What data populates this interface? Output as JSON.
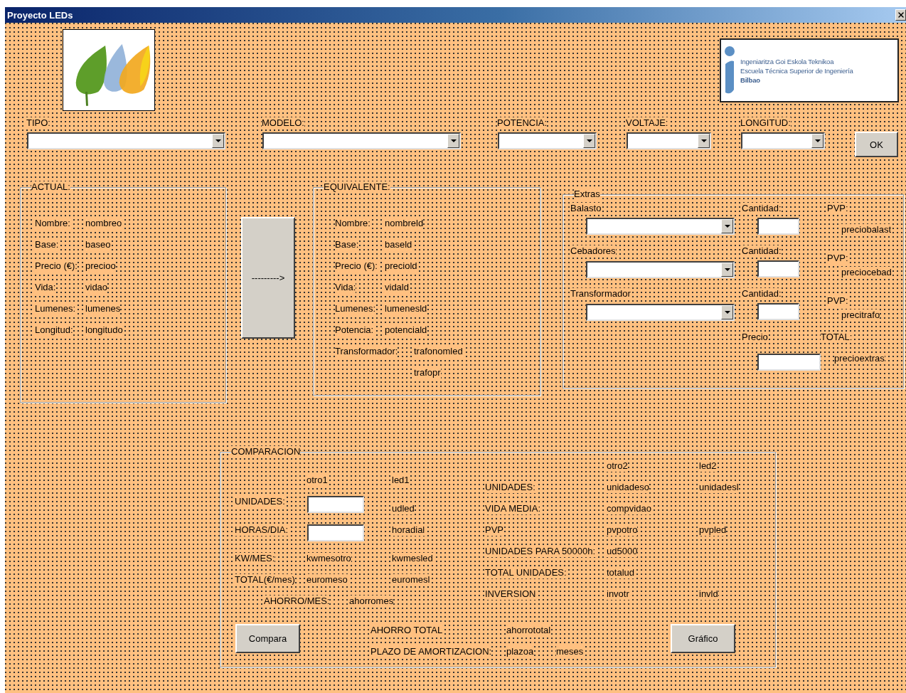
{
  "window": {
    "title": "Proyecto LEDs"
  },
  "university_logo": {
    "lines": [
      "Ingeniaritza Goi Eskola Teknikoa",
      "Escuela Técnica Superior de Ingeniería",
      "Bilbao"
    ]
  },
  "selectors": [
    {
      "label": "TIPO:"
    },
    {
      "label": "MODELO:"
    },
    {
      "label": "POTENCIA:"
    },
    {
      "label": "VOLTAJE:"
    },
    {
      "label": "LONGITUD:"
    }
  ],
  "ok_button": "OK",
  "actual": {
    "title": "ACTUAL:",
    "rows": [
      {
        "label": "Nombre:",
        "value": "nombreo"
      },
      {
        "label": "Base:",
        "value": "baseo"
      },
      {
        "label": "Precio (€):",
        "value": "precioo"
      },
      {
        "label": "Vida:",
        "value": "vidao"
      },
      {
        "label": "Lumenes:",
        "value": "lumenes"
      },
      {
        "label": "Longitud:",
        "value": "longitudo"
      }
    ]
  },
  "transfer_button": "--------->",
  "equivalente": {
    "title": "EQUIVALENTE:",
    "rows": [
      {
        "label": "Nombre:",
        "value": "nombreld"
      },
      {
        "label": "Base:",
        "value": "baseld"
      },
      {
        "label": "Precio (€):",
        "value": "preciold"
      },
      {
        "label": "Vida:",
        "value": "vidald"
      },
      {
        "label": "Lumenes:",
        "value": "lumenesld"
      },
      {
        "label": "Potencia:",
        "value": "potenciald"
      },
      {
        "label": "Transformador:",
        "value": "trafonomled"
      },
      {
        "value": "trafopr"
      }
    ]
  },
  "extras": {
    "title": "Extras",
    "items": [
      {
        "label": "Balasto",
        "qty_label": "Cantidad:",
        "pvp_label": "PVP:",
        "price": "preciobalast"
      },
      {
        "label": "Cebadores",
        "qty_label": "Cantidad:",
        "pvp_label": "PVP:",
        "price": "preciocebad"
      },
      {
        "label": "Transformador",
        "qty_label": "Cantidad:",
        "pvp_label": "PVP:",
        "price": "precitrafo"
      }
    ],
    "price_label": "Precio",
    "total_label": "TOTAL:",
    "total": "precioextras"
  },
  "comparacion": {
    "title": "COMPARACION",
    "left_headers": [
      "otro1",
      "led1"
    ],
    "left_rows": [
      {
        "kind": "input",
        "label": "UNIDADES:",
        "led": "udled"
      },
      {
        "kind": "input",
        "label": "HORAS/DIA:",
        "led": "horadial"
      },
      {
        "kind": "text",
        "label": "KW/MES:",
        "otro": "kwmesotro",
        "led": "kwmesled"
      },
      {
        "kind": "text",
        "label": "TOTAL(€/mes)",
        "otro": "euromeso",
        "led": "euromesl"
      }
    ],
    "monthly_saving": {
      "label": "AHORRO/MES:",
      "value": "ahorromes"
    },
    "right_headers": [
      "otro2",
      "led2"
    ],
    "right_rows": [
      {
        "label": "UNIDADES:",
        "otro": "unidadeso",
        "led": "unidadesl"
      },
      {
        "label": "VIDA MEDIA:",
        "otro": "compvidao"
      },
      {
        "label": "PVP",
        "otro": "pvpotro",
        "led": "pvpled"
      },
      {
        "label": "UNIDADES PARA 50000h:",
        "otro": "ud5000"
      },
      {
        "label": "TOTAL UNIDADES:",
        "otro": "totalud"
      },
      {
        "label": "INVERSION",
        "otro": "invotr",
        "led": "invld"
      }
    ],
    "compare_button": "Compara",
    "total_saving": {
      "label": "AHORRO TOTAL",
      "value": "ahorrototal"
    },
    "payback": {
      "label": "PLAZO DE AMORTIZACION:",
      "value": "plazoa",
      "unit": "meses"
    },
    "chart_button": "Gráfico"
  }
}
